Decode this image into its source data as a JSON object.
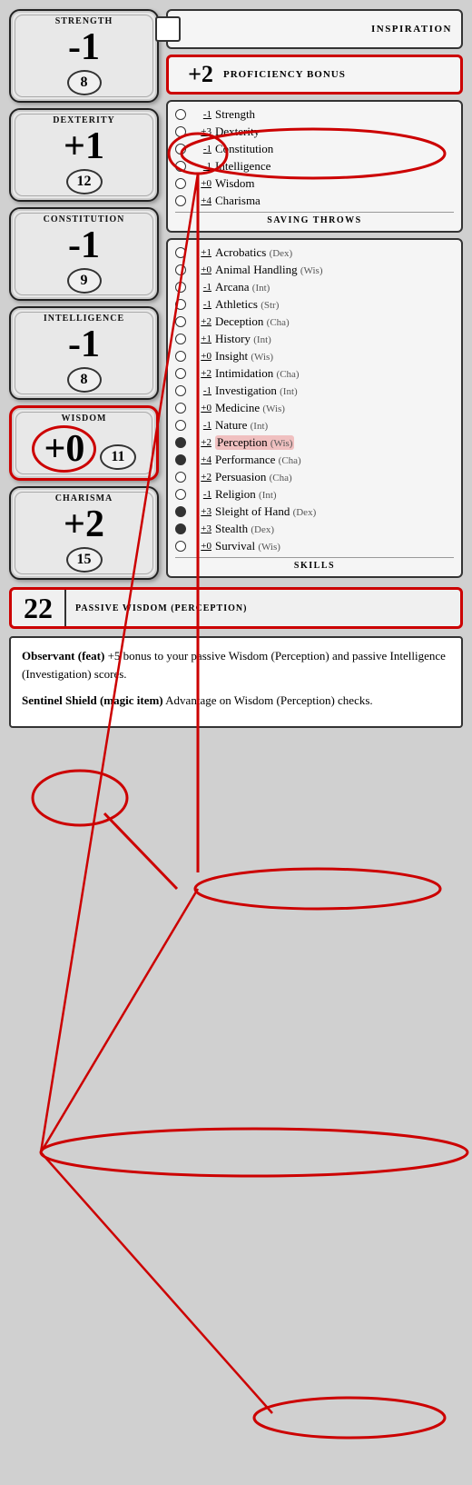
{
  "inspiration": {
    "label": "INSPIRATION"
  },
  "proficiency": {
    "value": "+2",
    "label": "PROFICIENCY BONUS"
  },
  "abilities": [
    {
      "name": "STRENGTH",
      "modifier": "-1",
      "score": "8"
    },
    {
      "name": "DEXTERITY",
      "modifier": "+1",
      "score": "12"
    },
    {
      "name": "CONSTITUTION",
      "modifier": "-1",
      "score": "9"
    },
    {
      "name": "INTELLIGENCE",
      "modifier": "-1",
      "score": "8"
    },
    {
      "name": "WISDOM",
      "modifier": "+0",
      "score": "11"
    },
    {
      "name": "CHARISMA",
      "modifier": "+2",
      "score": "15"
    }
  ],
  "saving_throws": {
    "title": "SAVING THROWS",
    "items": [
      {
        "modifier": "-1",
        "name": "Strength",
        "proficient": false
      },
      {
        "modifier": "+3",
        "name": "Dexterity",
        "proficient": false
      },
      {
        "modifier": "-1",
        "name": "Constitution",
        "proficient": false
      },
      {
        "modifier": "-1",
        "name": "Intelligence",
        "proficient": false
      },
      {
        "modifier": "+0",
        "name": "Wisdom",
        "proficient": false
      },
      {
        "modifier": "+4",
        "name": "Charisma",
        "proficient": false
      }
    ]
  },
  "skills": {
    "title": "SKILLS",
    "items": [
      {
        "modifier": "+1",
        "name": "Acrobatics",
        "attr": "Dex",
        "proficient": false
      },
      {
        "modifier": "+0",
        "name": "Animal Handling",
        "attr": "Wis",
        "proficient": false
      },
      {
        "modifier": "-1",
        "name": "Arcana",
        "attr": "Int",
        "proficient": false
      },
      {
        "modifier": "-1",
        "name": "Athletics",
        "attr": "Str",
        "proficient": false
      },
      {
        "modifier": "+2",
        "name": "Deception",
        "attr": "Cha",
        "proficient": false
      },
      {
        "modifier": "+1",
        "name": "History",
        "attr": "Int",
        "proficient": false
      },
      {
        "modifier": "+0",
        "name": "Insight",
        "attr": "Wis",
        "proficient": false
      },
      {
        "modifier": "+2",
        "name": "Intimidation",
        "attr": "Cha",
        "proficient": false
      },
      {
        "modifier": "-1",
        "name": "Investigation",
        "attr": "Int",
        "proficient": false
      },
      {
        "modifier": "+0",
        "name": "Medicine",
        "attr": "Wis",
        "proficient": false
      },
      {
        "modifier": "-1",
        "name": "Nature",
        "attr": "Int",
        "proficient": false
      },
      {
        "modifier": "+2",
        "name": "Perception",
        "attr": "Wis",
        "proficient": true
      },
      {
        "modifier": "+4",
        "name": "Performance",
        "attr": "Cha",
        "proficient": true
      },
      {
        "modifier": "+2",
        "name": "Persuasion",
        "attr": "Cha",
        "proficient": false
      },
      {
        "modifier": "-1",
        "name": "Religion",
        "attr": "Int",
        "proficient": false
      },
      {
        "modifier": "+3",
        "name": "Sleight of Hand",
        "attr": "Dex",
        "proficient": true
      },
      {
        "modifier": "+3",
        "name": "Stealth",
        "attr": "Dex",
        "proficient": true
      },
      {
        "modifier": "+0",
        "name": "Survival",
        "attr": "Wis",
        "proficient": false
      }
    ]
  },
  "passive_wisdom": {
    "value": "22",
    "label": "PASSIVE WISDOM (PERCEPTION)"
  },
  "notes": [
    {
      "title": "Observant (feat)",
      "text": "+5 bonus to your passive Wisdom (Perception) and passive Intelligence (Investigation) scores."
    },
    {
      "title": "Sentinel Shield (magic item)",
      "text": "Advantage on Wisdom (Perception) checks."
    }
  ]
}
